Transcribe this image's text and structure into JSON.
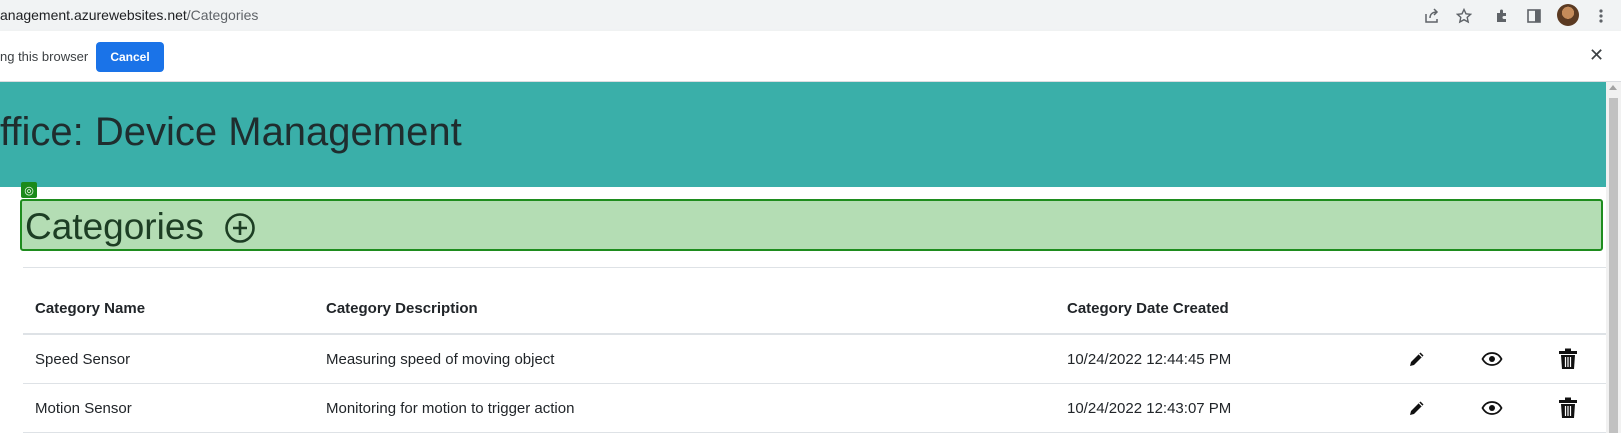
{
  "browser": {
    "url_host": "anagement.azurewebsites.net",
    "url_path": "/Categories"
  },
  "infobar": {
    "text": "ng this browser",
    "cancel_label": "Cancel",
    "close_glyph": "✕"
  },
  "banner": {
    "title": "ffice: Device Management"
  },
  "section": {
    "title": "Categories",
    "target_glyph": "◎"
  },
  "table": {
    "headers": [
      "Category Name",
      "Category Description",
      "Category Date Created",
      ""
    ],
    "rows": [
      {
        "name": "Speed Sensor",
        "description": "Measuring speed of moving object",
        "created": "10/24/2022 12:44:45 PM"
      },
      {
        "name": "Motion Sensor",
        "description": "Monitoring for motion to trigger action",
        "created": "10/24/2022 12:43:07 PM"
      }
    ]
  },
  "icons": {
    "toolbar": [
      "share-icon",
      "star-icon",
      "extensions-icon",
      "side-panel-icon",
      "avatar",
      "more-vert-icon"
    ],
    "row_actions": [
      "edit-pencil-icon",
      "view-eye-icon",
      "delete-trash-icon"
    ]
  },
  "colors": {
    "banner": "#3aafa9",
    "highlight_fill": "#b4ddb4",
    "highlight_border": "#1e8c1e",
    "button": "#1a73e8"
  }
}
